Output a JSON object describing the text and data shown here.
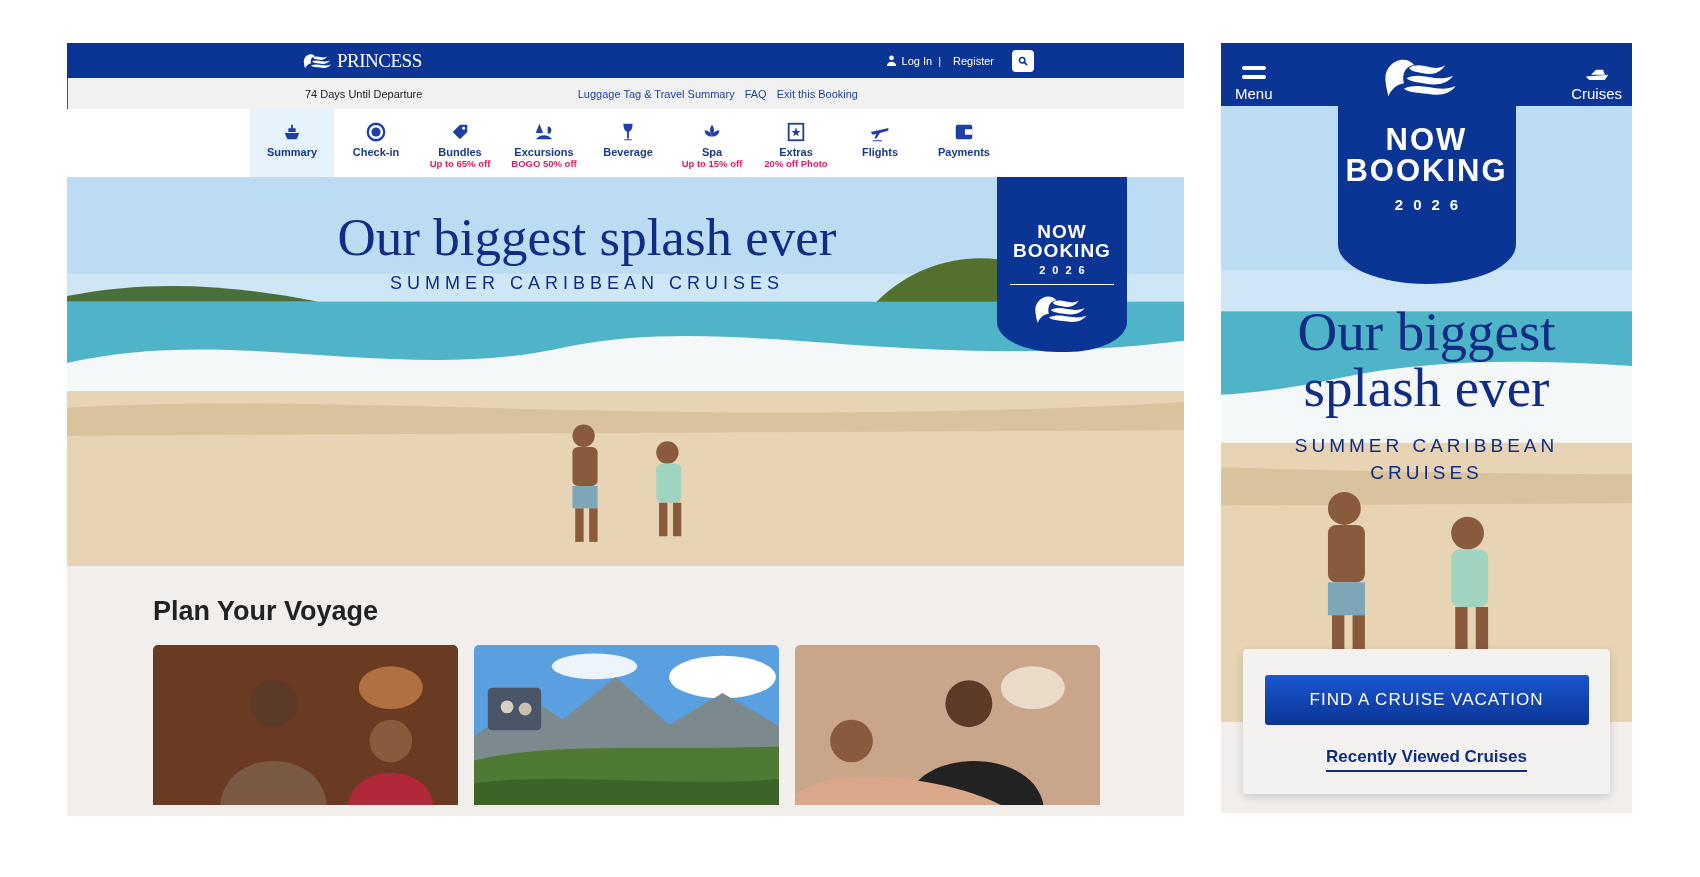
{
  "desktop": {
    "header": {
      "brand": "PRINCESS",
      "login": "Log In",
      "separator": "|",
      "register": "Register"
    },
    "subbar": {
      "countdown": "74 Days Until Departure",
      "links": [
        "Luggage Tag & Travel Summary",
        "FAQ",
        "Exit this Booking"
      ]
    },
    "nav": [
      {
        "label": "Summary",
        "selected": true
      },
      {
        "label": "Check-in",
        "selected": false
      },
      {
        "label": "Bundles",
        "promo": "Up to 65% off",
        "selected": false
      },
      {
        "label": "Excursions",
        "promo": "BOGO 50% off",
        "selected": false
      },
      {
        "label": "Beverage",
        "selected": false
      },
      {
        "label": "Spa",
        "promo": "Up to 15% off",
        "selected": false
      },
      {
        "label": "Extras",
        "promo": "20% off Photo",
        "selected": false
      },
      {
        "label": "Flights",
        "selected": false
      },
      {
        "label": "Payments",
        "selected": false
      }
    ],
    "hero": {
      "headline": "Our biggest splash ever",
      "subline": "SUMMER CARIBBEAN CRUISES",
      "banner": [
        "NOW",
        "BOOKING",
        "2026"
      ]
    },
    "section": {
      "title": "Plan Your Voyage"
    }
  },
  "mobile": {
    "header": {
      "menu": "Menu",
      "cruises": "Cruises"
    },
    "hero": {
      "banner": [
        "NOW",
        "BOOKING",
        "2026"
      ],
      "headline": "Our biggest splash ever",
      "subline": "SUMMER CARIBBEAN CRUISES"
    },
    "cta": {
      "button": "FIND A CRUISE VACATION",
      "link": "Recently Viewed Cruises"
    }
  }
}
